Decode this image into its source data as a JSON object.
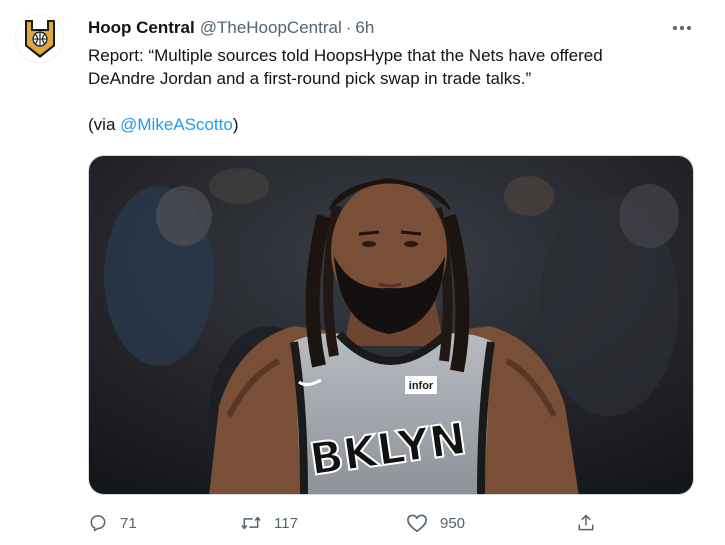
{
  "tweet": {
    "author_name": "Hoop Central",
    "author_handle": "@TheHoopCentral",
    "separator": "·",
    "time": "6h",
    "text_line1": "Report: “Multiple sources told HoopsHype that the Nets have offered",
    "text_line2": "DeAndre Jordan and a first-round pick swap in trade talks.”",
    "via_prefix": "(via ",
    "via_mention": "@MikeAScotto",
    "via_suffix": ")",
    "media": {
      "jersey_text": "BKLYN",
      "sponsor_text": "infor"
    }
  },
  "actions": {
    "replies": "71",
    "retweets": "117",
    "likes": "950"
  },
  "colors": {
    "text": "#0f1419",
    "secondary": "#536471",
    "link": "#1d9bf0",
    "logo_gold": "#e0a73a",
    "logo_dark": "#1a1a1a"
  },
  "icons": [
    "more-icon",
    "reply-icon",
    "retweet-icon",
    "like-icon",
    "share-icon"
  ]
}
